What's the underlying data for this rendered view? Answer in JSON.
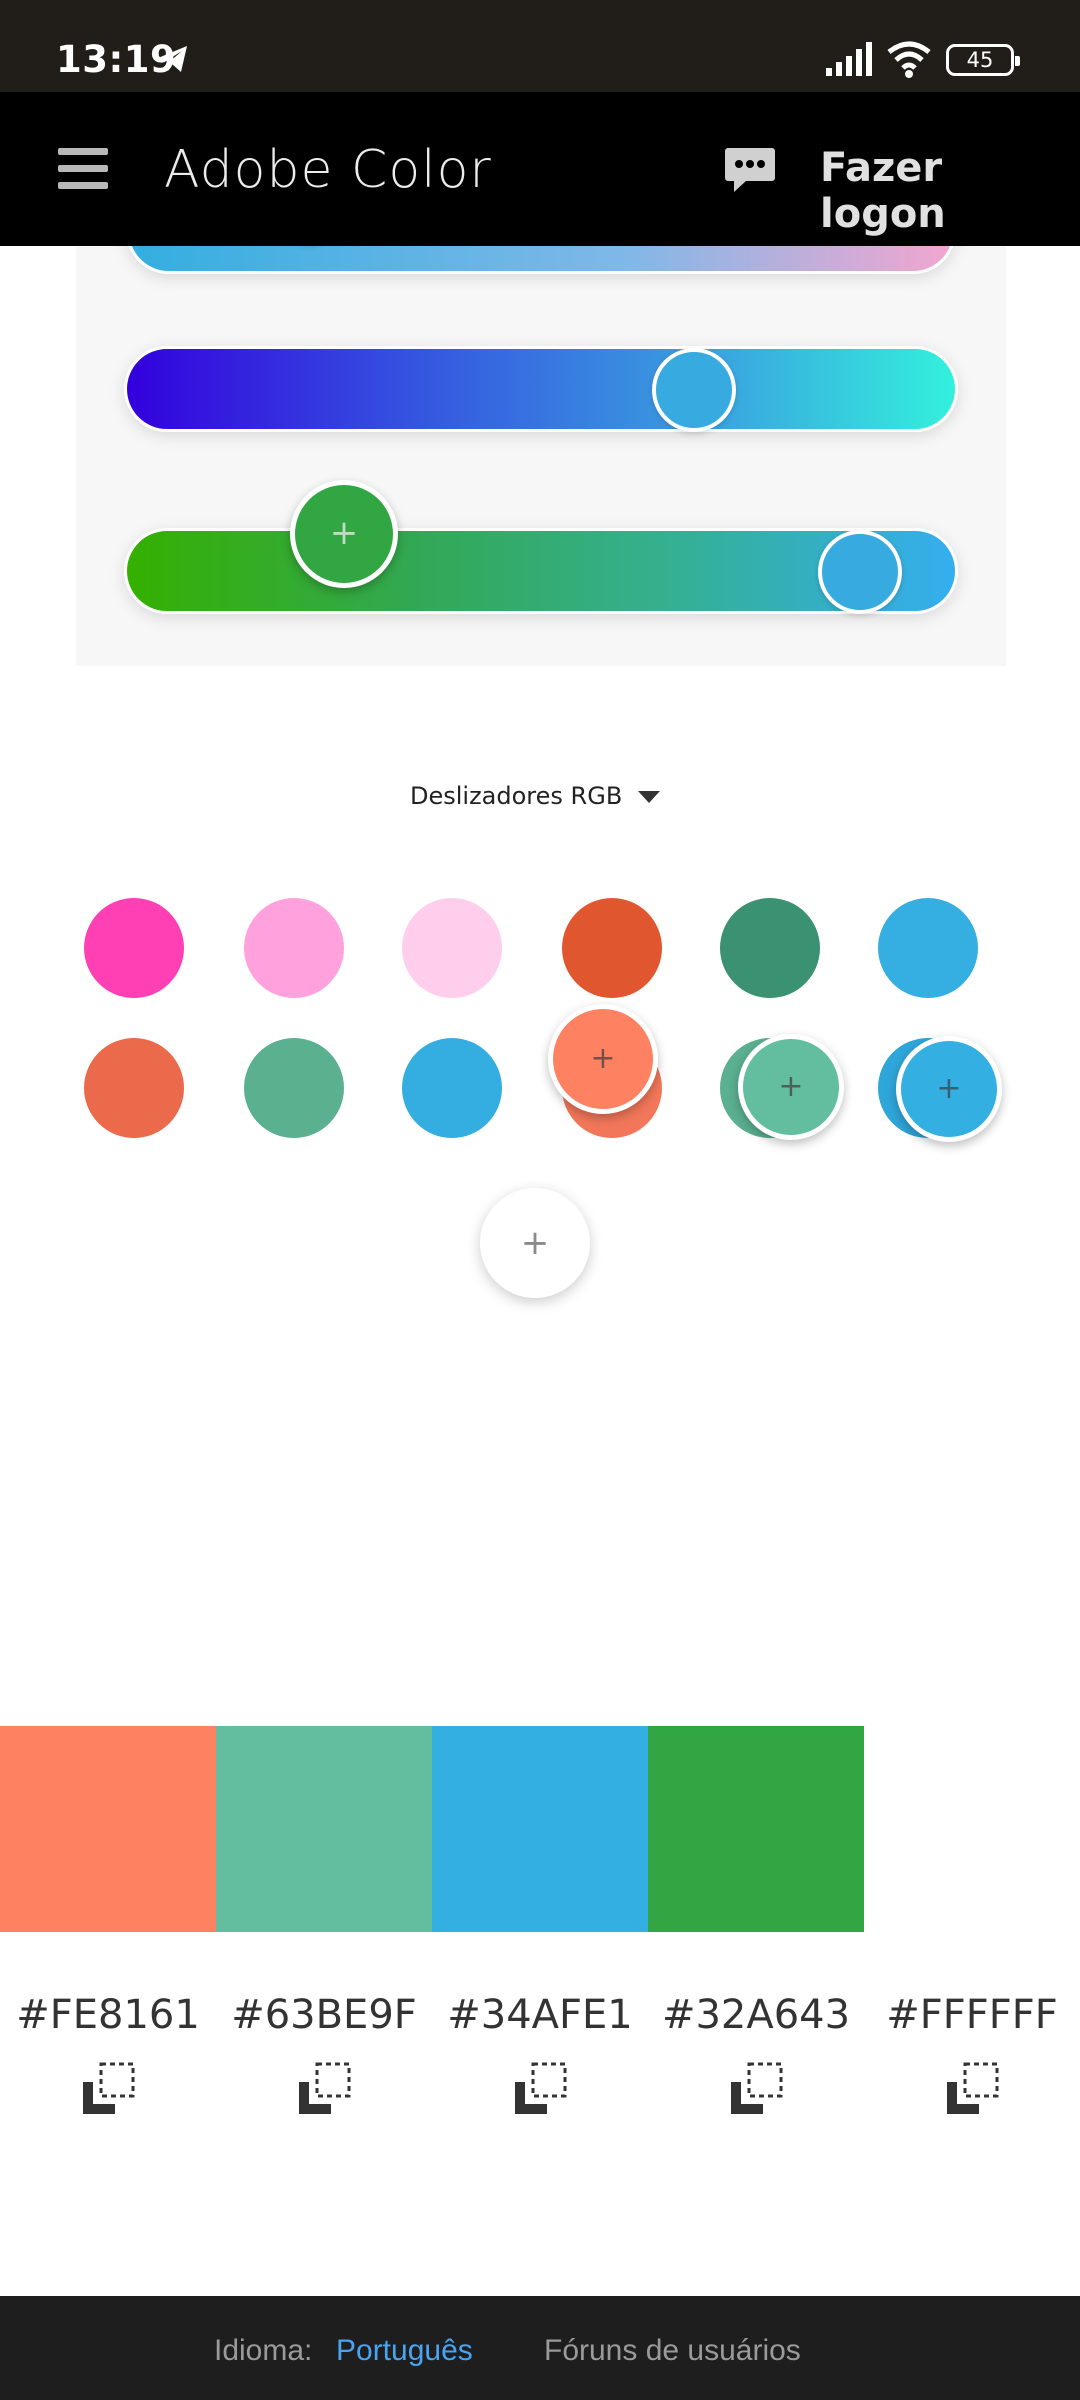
{
  "status_bar": {
    "time": "13:19",
    "battery_level": "45",
    "icons": [
      "telegram-icon",
      "signal-icon",
      "wifi-icon",
      "battery-icon"
    ]
  },
  "header": {
    "title": "Adobe Color",
    "login_label": "Fazer logon",
    "icons": [
      "menu-icon",
      "chat-icon"
    ]
  },
  "color_wheel": {
    "mode_dropdown": "Deslizadores RGB",
    "sliders": [
      {
        "name": "red",
        "value_fraction": 0.19
      },
      {
        "name": "green",
        "value_fraction": 0.72
      },
      {
        "name": "blue",
        "value_fraction": 0.92
      }
    ],
    "swatch_rows": [
      [
        "#FF3FB4",
        "#FFA1DC",
        "#FFCEEC",
        "#E0572F",
        "#3A9272",
        "#35AEE1"
      ],
      [
        "#EC6A4C",
        "#5BB090",
        "#34AEE1",
        "#FE8161",
        "#63BE9F",
        "#34AFE1"
      ]
    ],
    "add_button_label": "+"
  },
  "palette": {
    "colors": [
      {
        "hex": "#FE8161",
        "color": "#FE8161"
      },
      {
        "hex": "#63BE9F",
        "color": "#63BE9F"
      },
      {
        "hex": "#34AFE1",
        "color": "#34AFE1"
      },
      {
        "hex": "#32A643",
        "color": "#32A643"
      },
      {
        "hex": "#FFFFFF",
        "color": "#FFFFFF"
      }
    ],
    "hex_labels": [
      "#FE8161",
      "#63BE9F",
      "#34AFE1",
      "#32A643",
      "#FFFFFF"
    ]
  },
  "footer": {
    "language_label": "Idioma:",
    "language_value": "Português",
    "forums_label": "Fóruns de usuários"
  }
}
